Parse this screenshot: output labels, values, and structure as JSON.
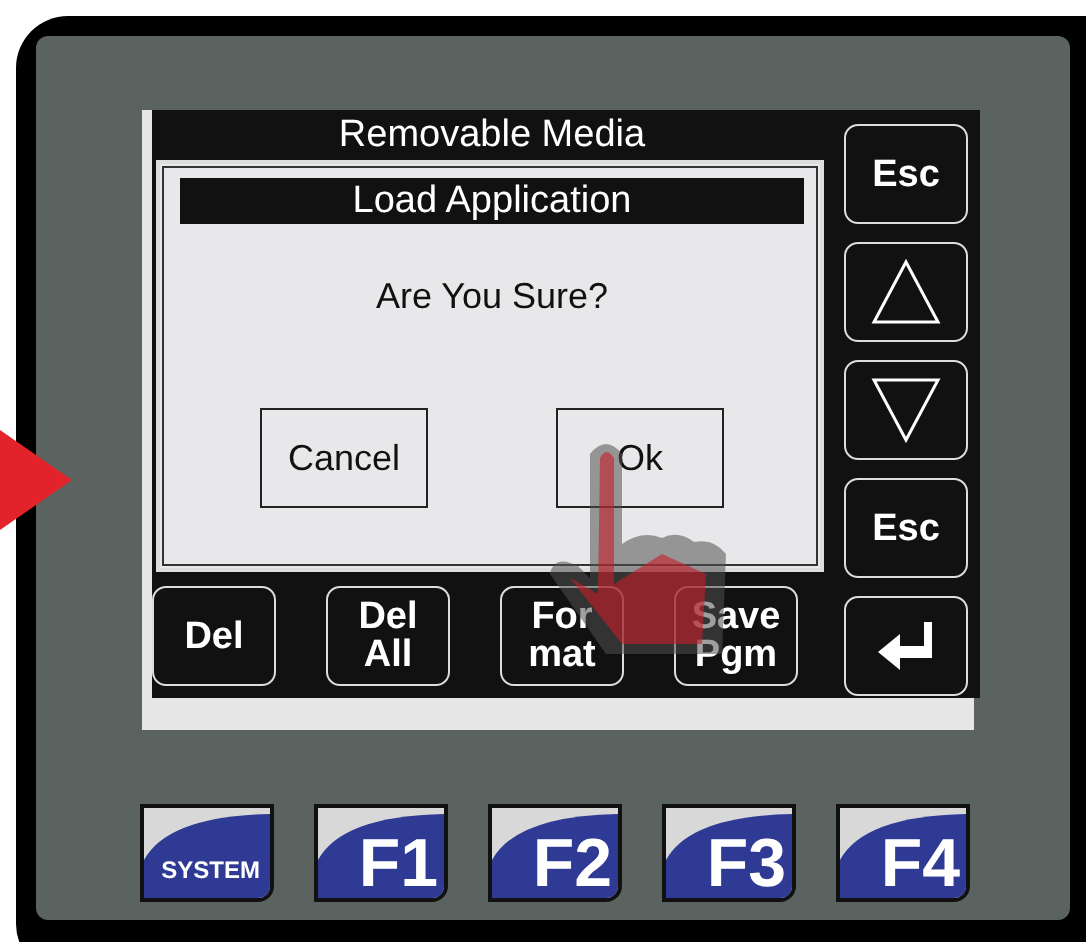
{
  "screen": {
    "title": "Removable Media",
    "dialog": {
      "title": "Load Application",
      "message": "Are You Sure?",
      "buttons": [
        {
          "label": "Cancel"
        },
        {
          "label": "Ok"
        }
      ]
    },
    "softkeys": [
      {
        "label": "Del"
      },
      {
        "label": "Del All"
      },
      {
        "label": "For mat"
      },
      {
        "label": "Save Pgm"
      }
    ],
    "side_keys": [
      {
        "kind": "text",
        "label": "Esc"
      },
      {
        "kind": "up"
      },
      {
        "kind": "down"
      },
      {
        "kind": "text",
        "label": "Esc"
      },
      {
        "kind": "enter"
      }
    ]
  },
  "function_keys": [
    {
      "kind": "system",
      "label": "SYSTEM"
    },
    {
      "kind": "fkey",
      "label": "F1"
    },
    {
      "kind": "fkey",
      "label": "F2"
    },
    {
      "kind": "fkey",
      "label": "F3"
    },
    {
      "kind": "fkey",
      "label": "F4"
    }
  ]
}
